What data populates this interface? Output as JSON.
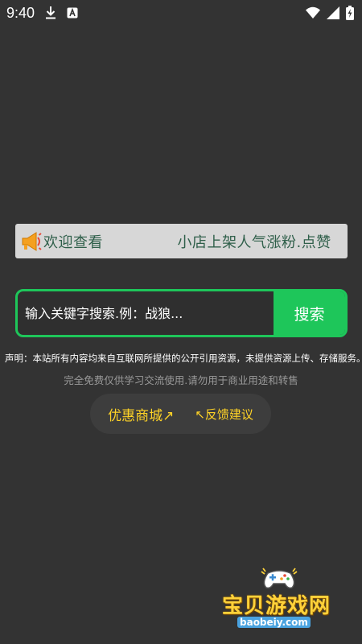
{
  "status_bar": {
    "time": "9:40",
    "icons": [
      "download-icon",
      "app-a-icon",
      "wifi-icon",
      "signal-icon",
      "battery-charging-icon"
    ]
  },
  "notice": {
    "icon": "megaphone-icon",
    "text": "欢迎查看　　　　　小店上架人气涨粉.点赞"
  },
  "search": {
    "placeholder": "输入关键字搜索.例：战狼...",
    "button_label": "搜索"
  },
  "disclaimer": "声明：本站所有内容均来自互联网所提供的公开引用资源，未提供资源上传、存储服务。",
  "free_note": "完全免费仅供学习交流使用.请勿用于商业用途和转售",
  "links": {
    "shop": "优惠商城↗",
    "feedback": "↖反馈建议"
  },
  "watermark": {
    "brand": "宝贝游戏网",
    "domain": "baobeiy.com"
  },
  "colors": {
    "background": "#333333",
    "accent_green": "#1ec65a",
    "link_yellow": "#ffd326",
    "notice_bg": "#d7d7d7",
    "notice_text": "#2f5f4a"
  }
}
